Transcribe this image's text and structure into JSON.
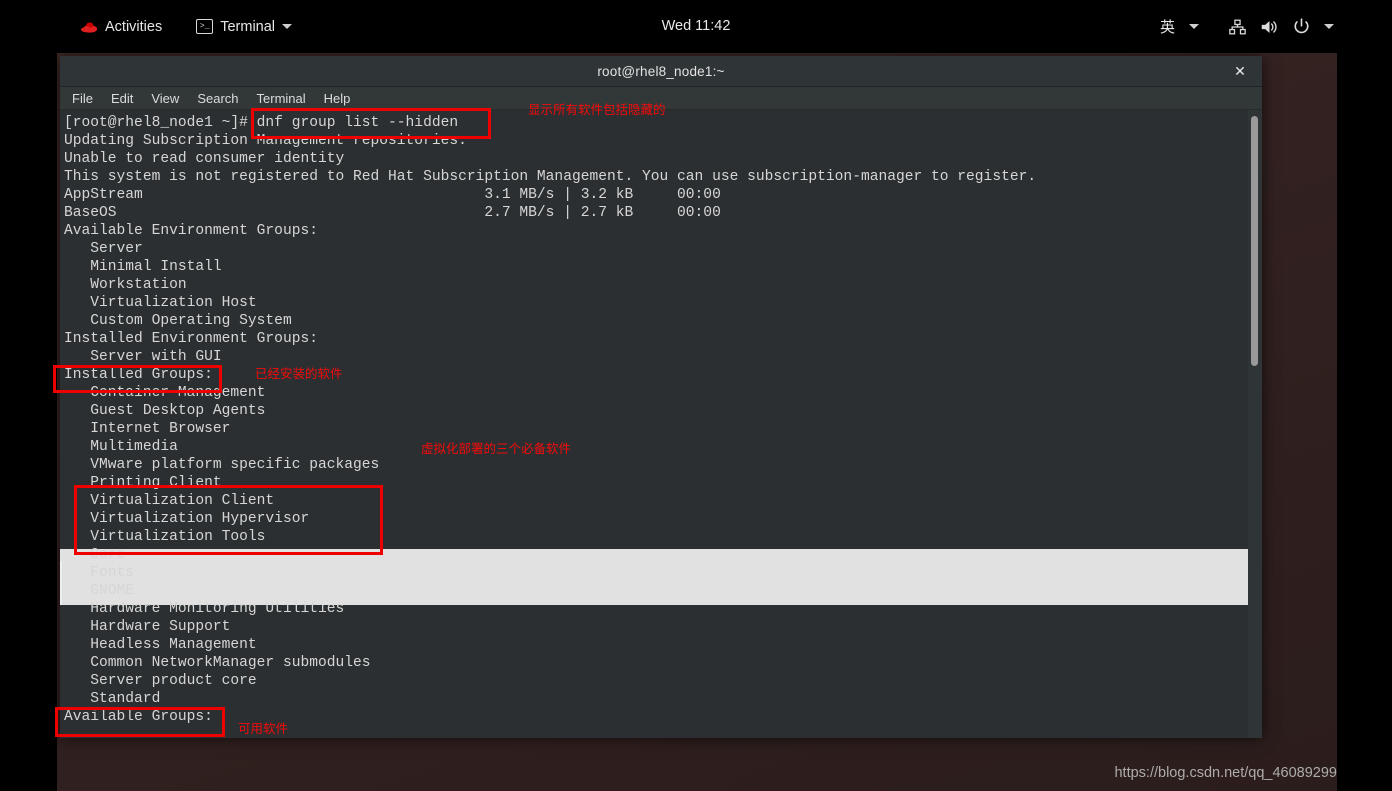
{
  "topbar": {
    "activities_label": "Activities",
    "app_label": "Terminal",
    "app_icon": "terminal-icon",
    "logo_icon": "redhat-logo-icon",
    "clock": "Wed 11:42",
    "ime_label": "英",
    "network_icon": "network-icon",
    "volume_icon": "volume-icon",
    "power_icon": "power-icon",
    "chevron_icon": "chevron-down-icon"
  },
  "window": {
    "title": "root@rhel8_node1:~",
    "close_label": "✕",
    "menus": [
      "File",
      "Edit",
      "View",
      "Search",
      "Terminal",
      "Help"
    ]
  },
  "terminal": {
    "prompt": "[root@rhel8_node1 ~]# ",
    "command": "dnf group list --hidden",
    "lines": [
      "[root@rhel8_node1 ~]# dnf group list --hidden",
      "Updating Subscription Management repositories.",
      "Unable to read consumer identity",
      "This system is not registered to Red Hat Subscription Management. You can use subscription-manager to register.",
      "AppStream                                       3.1 MB/s | 3.2 kB     00:00",
      "BaseOS                                          2.7 MB/s | 2.7 kB     00:00",
      "Available Environment Groups:",
      "   Server",
      "   Minimal Install",
      "   Workstation",
      "   Virtualization Host",
      "   Custom Operating System",
      "Installed Environment Groups:",
      "   Server with GUI",
      "Installed Groups:",
      "   Container Management",
      "   Guest Desktop Agents",
      "   Internet Browser",
      "   Multimedia",
      "   VMware platform specific packages",
      "   Printing Client",
      "   Virtualization Client",
      "   Virtualization Hypervisor",
      "   Virtualization Tools",
      "   Core",
      "   Fonts",
      "   GNOME",
      "   Hardware Monitoring Utilities",
      "   Hardware Support",
      "   Headless Management",
      "   Common NetworkManager submodules",
      "   Server product core",
      "   Standard",
      "Available Groups:"
    ]
  },
  "annotations": {
    "command_note": "显示所有软件包括隐藏的",
    "installed_note": "已经安装的软件",
    "virtualization_note": "虚拟化部署的三个必备软件",
    "available_note": "可用软件",
    "box_color": "#ee0000",
    "text_color": "#f40b0b"
  },
  "watermark": "https://blog.csdn.net/qq_46089299"
}
